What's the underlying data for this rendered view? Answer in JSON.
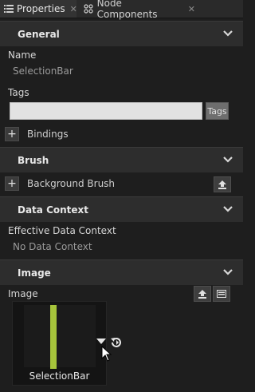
{
  "tabs": [
    {
      "label": "Properties"
    },
    {
      "label": "Node Components"
    }
  ],
  "general": {
    "title": "General",
    "name_label": "Name",
    "name_value": "SelectionBar",
    "tags_label": "Tags",
    "tags_input_value": "",
    "tags_button": "Tags",
    "bindings_label": "Bindings"
  },
  "brush": {
    "title": "Brush",
    "background_brush_label": "Background Brush"
  },
  "data_context": {
    "title": "Data Context",
    "effective_label": "Effective Data Context",
    "effective_value": "No Data Context"
  },
  "image": {
    "title": "Image",
    "image_label": "Image",
    "thumbnail_caption": "SelectionBar"
  },
  "colors": {
    "background": "#1e1e1e",
    "section_header": "#2d2d2d",
    "accent_bar": "#a6c43b"
  }
}
